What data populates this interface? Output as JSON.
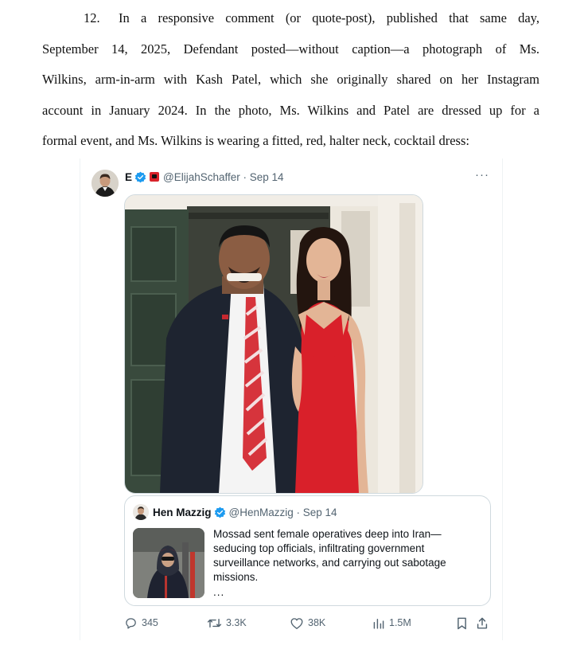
{
  "paragraph": {
    "number": "12.",
    "line1": "In a responsive comment (or quote-post), published that same day,",
    "line2": "September 14, 2025, Defendant posted—without caption—a photograph of Ms.",
    "line3": "Wilkins, arm-in-arm with Kash Patel, which she originally shared on her Instagram",
    "line4": "account in January 2024. In the photo, Ms. Wilkins and Patel are dressed up for a",
    "line5": "formal event, and Ms. Wilkins is wearing a fitted, red, halter neck, cocktail dress:"
  },
  "tweet": {
    "author_name": "E",
    "handle_date": "@ElijahSchaffer · Sep 14",
    "more": "···",
    "quote": {
      "author_name": "Hen Mazzig",
      "handle_date": "@HenMazzig · Sep 14",
      "text": "Mossad sent female operatives deep into Iran—seducing top officials, infiltrating government surveillance networks, and carrying out sabotage missions.",
      "ellipsis": "..."
    },
    "actions": {
      "replies": "345",
      "reposts": "3.3K",
      "likes": "38K",
      "views": "1.5M"
    },
    "colors": {
      "verified": "#1d9bf0",
      "muted": "#536471",
      "dress": "#d9202a"
    }
  }
}
